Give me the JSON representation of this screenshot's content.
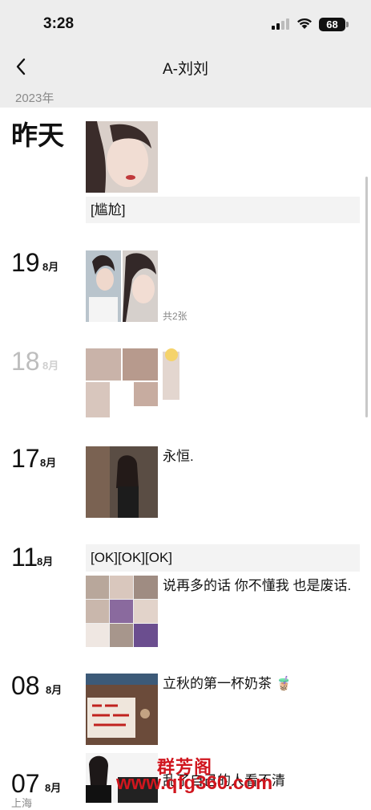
{
  "status": {
    "time": "3:28",
    "battery": "68"
  },
  "nav": {
    "title": "A-刘刘",
    "back_icon": "chevron-left-icon"
  },
  "year_label": "2023年",
  "entries": [
    {
      "day": "昨天",
      "text": "[尴尬]"
    },
    {
      "day": "19",
      "month": "8月",
      "photo_count": "共2张"
    },
    {
      "day": "18",
      "month": "8月"
    },
    {
      "day": "17",
      "month": "8月",
      "caption": "永恒."
    },
    {
      "day": "11",
      "month": "8月",
      "text": "[OK][OK][OK]",
      "caption": "说再多的话 你不懂我 也是废话."
    },
    {
      "day": "08",
      "month": "8月",
      "caption": "立秋的第一杯奶茶 🧋"
    },
    {
      "day": "07",
      "month": "8月",
      "caption": "乱了自己的人看不清",
      "sub": "上海"
    }
  ],
  "watermark": {
    "name": "群芳阁",
    "url": "www.qfg360.com"
  },
  "colors": {
    "header_bg": "#ededed",
    "text_box_bg": "#f3f3f3",
    "watermark": "#d0161e"
  }
}
